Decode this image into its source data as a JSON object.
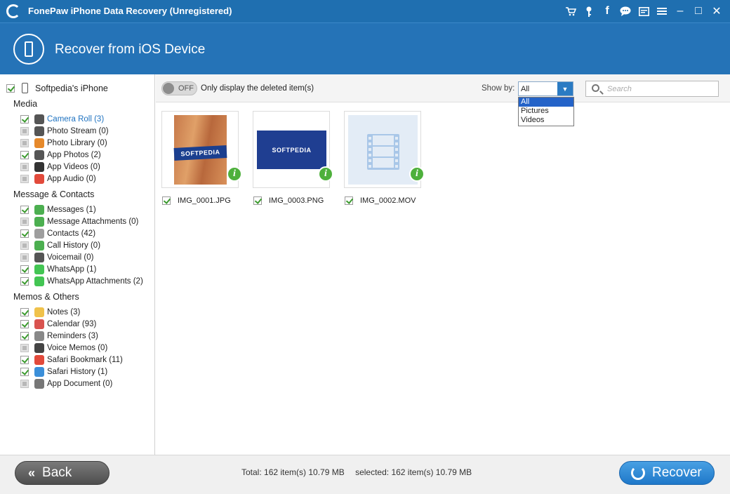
{
  "window": {
    "title": "FonePaw iPhone Data Recovery (Unregistered)",
    "icons": [
      "cart-icon",
      "key-icon",
      "facebook-icon",
      "chat-icon",
      "feedback-icon",
      "menu-icon"
    ],
    "controls": {
      "minimize": "–",
      "maximize": "□",
      "close": "✕"
    }
  },
  "header": {
    "title": "Recover from iOS Device"
  },
  "sidebar": {
    "device": {
      "label": "Softpedia's iPhone",
      "checked": true
    },
    "groups": [
      {
        "title": "Media",
        "items": [
          {
            "label": "Camera Roll (3)",
            "checked": true,
            "icon": "camera-icon",
            "color": "#555555",
            "active": true
          },
          {
            "label": "Photo Stream (0)",
            "checked": false,
            "icon": "photo-stream-icon",
            "color": "#555555"
          },
          {
            "label": "Photo Library (0)",
            "checked": false,
            "icon": "photo-library-icon",
            "color": "#e6892b"
          },
          {
            "label": "App Photos (2)",
            "checked": true,
            "icon": "app-photos-icon",
            "color": "#555555"
          },
          {
            "label": "App Videos (0)",
            "checked": false,
            "icon": "app-videos-icon",
            "color": "#333333"
          },
          {
            "label": "App Audio (0)",
            "checked": false,
            "icon": "app-audio-icon",
            "color": "#e24a3b"
          }
        ]
      },
      {
        "title": "Message & Contacts",
        "items": [
          {
            "label": "Messages (1)",
            "checked": true,
            "icon": "messages-icon",
            "color": "#4caf50"
          },
          {
            "label": "Message Attachments (0)",
            "checked": false,
            "icon": "attachment-icon",
            "color": "#4caf50"
          },
          {
            "label": "Contacts (42)",
            "checked": true,
            "icon": "contacts-icon",
            "color": "#9e9e9e"
          },
          {
            "label": "Call History (0)",
            "checked": false,
            "icon": "phone-icon",
            "color": "#4caf50"
          },
          {
            "label": "Voicemail (0)",
            "checked": false,
            "icon": "voicemail-icon",
            "color": "#555555"
          },
          {
            "label": "WhatsApp (1)",
            "checked": true,
            "icon": "whatsapp-icon",
            "color": "#43c553"
          },
          {
            "label": "WhatsApp Attachments (2)",
            "checked": true,
            "icon": "attachment-icon",
            "color": "#43c553"
          }
        ]
      },
      {
        "title": "Memos & Others",
        "items": [
          {
            "label": "Notes (3)",
            "checked": true,
            "icon": "notes-icon",
            "color": "#f0c24b"
          },
          {
            "label": "Calendar (93)",
            "checked": true,
            "icon": "calendar-icon",
            "color": "#d9534f"
          },
          {
            "label": "Reminders (3)",
            "checked": true,
            "icon": "reminders-icon",
            "color": "#888888"
          },
          {
            "label": "Voice Memos (0)",
            "checked": false,
            "icon": "voice-memo-icon",
            "color": "#444444"
          },
          {
            "label": "Safari Bookmark (11)",
            "checked": true,
            "icon": "bookmark-icon",
            "color": "#e24a3b"
          },
          {
            "label": "Safari History (1)",
            "checked": true,
            "icon": "safari-icon",
            "color": "#3b8fd9"
          },
          {
            "label": "App Document (0)",
            "checked": false,
            "icon": "document-icon",
            "color": "#777777"
          }
        ]
      }
    ]
  },
  "toolbar": {
    "toggle_text": "OFF",
    "toggle_label": "Only display the deleted item(s)",
    "show_by_label": "Show by:",
    "show_by_value": "All",
    "show_by_options": [
      "All",
      "Pictures",
      "Videos"
    ],
    "search_placeholder": "Search"
  },
  "files": [
    {
      "name": "IMG_0001.JPG",
      "checked": true,
      "kind": "photo",
      "thumb_text": "SOFTPEDIA"
    },
    {
      "name": "IMG_0003.PNG",
      "checked": true,
      "kind": "image",
      "thumb_text": "SOFTPEDIA"
    },
    {
      "name": "IMG_0002.MOV",
      "checked": true,
      "kind": "video",
      "thumb_text": ""
    }
  ],
  "footer": {
    "back_label": "Back",
    "total": "Total: 162 item(s) 10.79 MB",
    "selected": "selected: 162 item(s) 10.79 MB",
    "recover_label": "Recover"
  }
}
